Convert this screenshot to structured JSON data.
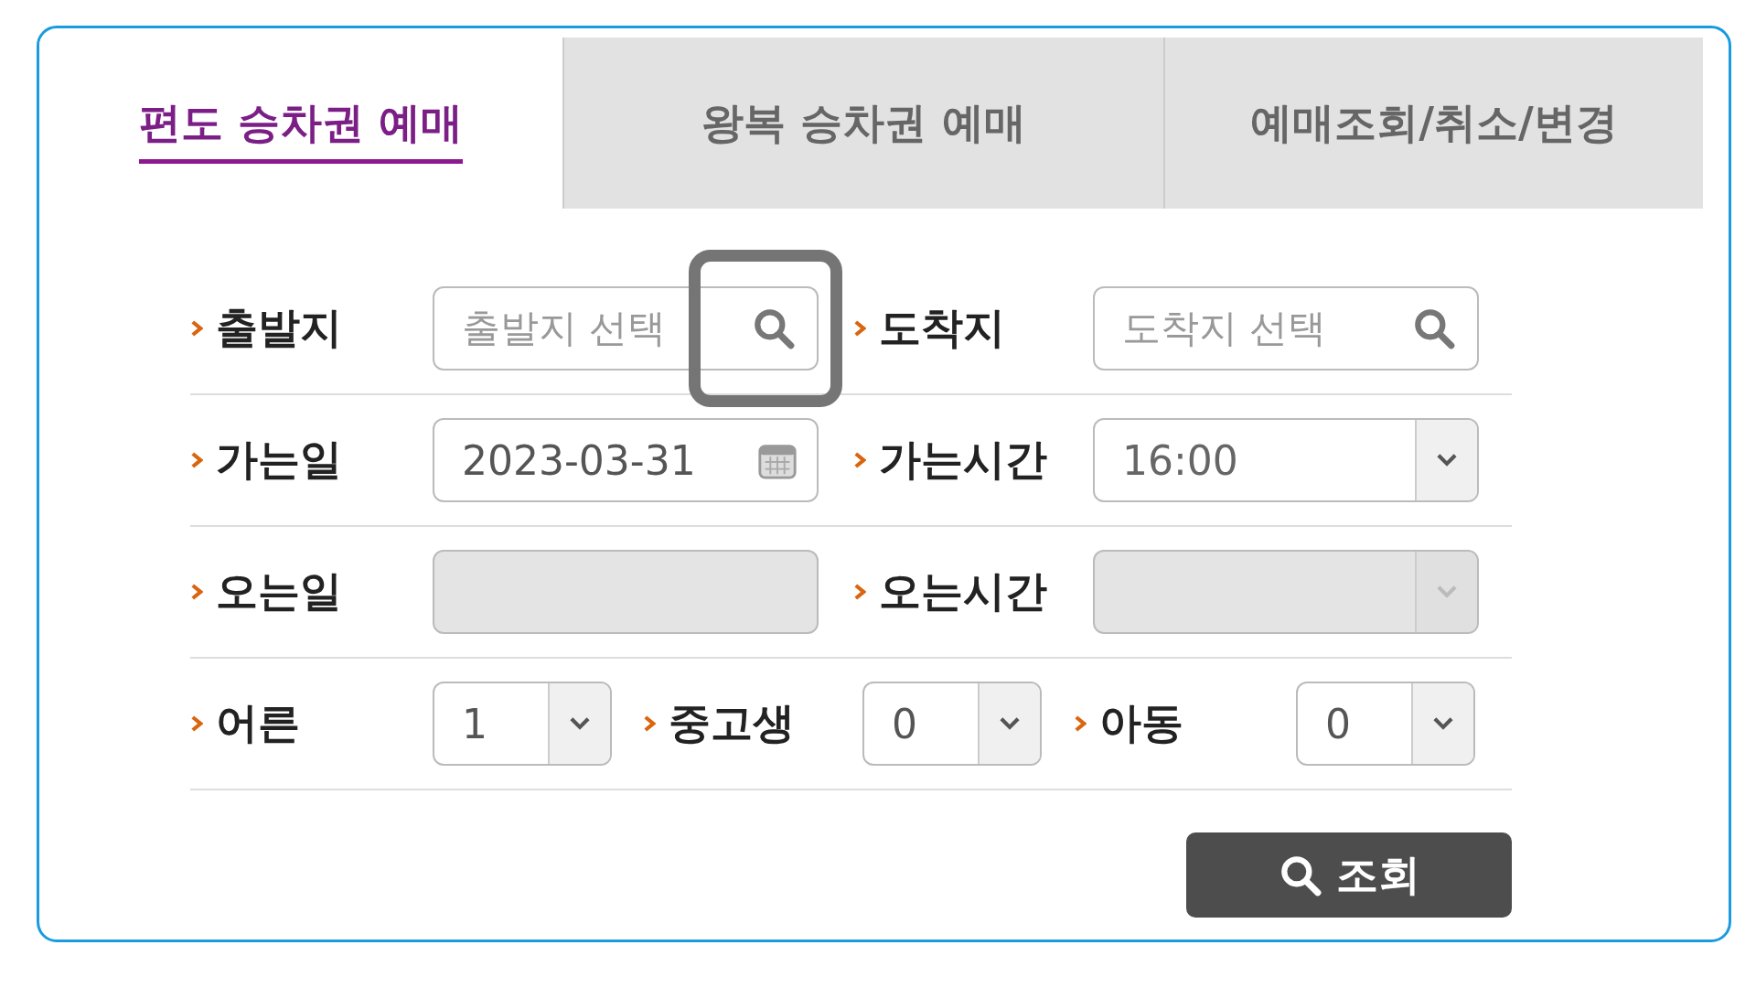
{
  "tabs": [
    {
      "label": "편도 승차권 예매",
      "selected": true
    },
    {
      "label": "왕복 승차권 예매",
      "selected": false
    },
    {
      "label": "예매조회/취소/변경",
      "selected": false
    }
  ],
  "rows": [
    {
      "fields": [
        {
          "label": "출발지",
          "kind": "search",
          "placeholder": "출발지 선택",
          "disabled": false,
          "highlighted": true
        },
        {
          "label": "도착지",
          "kind": "search",
          "placeholder": "도착지 선택",
          "disabled": false
        }
      ]
    },
    {
      "fields": [
        {
          "label": "가는일",
          "kind": "date",
          "value": "2023-03-31",
          "disabled": false
        },
        {
          "label": "가는시간",
          "kind": "select",
          "value": "16:00",
          "disabled": false
        }
      ]
    },
    {
      "fields": [
        {
          "label": "오는일",
          "kind": "date",
          "disabled": true
        },
        {
          "label": "오는시간",
          "kind": "select",
          "disabled": true
        }
      ]
    }
  ],
  "passengers": [
    {
      "label": "어른",
      "value": "1"
    },
    {
      "label": "중고생",
      "value": "0"
    },
    {
      "label": "아동",
      "value": "0"
    }
  ],
  "search_button": {
    "label": "조회"
  }
}
